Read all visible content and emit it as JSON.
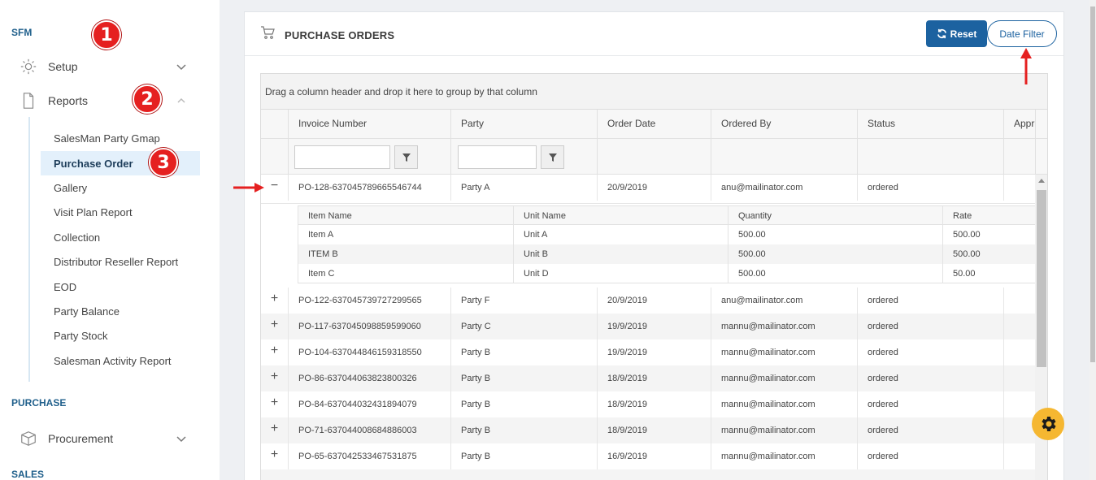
{
  "sidebar": {
    "section_sfm": "SFM",
    "setup_label": "Setup",
    "reports_label": "Reports",
    "sub_items": [
      "SalesMan Party Gmap",
      "Purchase Order",
      "Gallery",
      "Visit Plan Report",
      "Collection",
      "Distributor Reseller Report",
      "EOD",
      "Party Balance",
      "Party Stock",
      "Salesman Activity Report"
    ],
    "active_item": "Purchase Order",
    "section_purchase": "PURCHASE",
    "procurement_label": "Procurement",
    "section_sales": "SALES"
  },
  "badges": [
    "1",
    "2",
    "3"
  ],
  "header": {
    "title": "PURCHASE ORDERS",
    "reset_label": "Reset",
    "date_filter_label": "Date Filter"
  },
  "grid": {
    "group_hint": "Drag a column header and drop it here to group by that column",
    "columns": [
      "Invoice Number",
      "Party",
      "Order Date",
      "Ordered By",
      "Status",
      "Appr"
    ],
    "rows": [
      {
        "expander": "−",
        "invoice": "PO-128-637045789665546744",
        "party": "Party A",
        "date": "20/9/2019",
        "by": "anu@mailinator.com",
        "status": "ordered"
      },
      {
        "expander": "+",
        "invoice": "PO-122-637045739727299565",
        "party": "Party F",
        "date": "20/9/2019",
        "by": "anu@mailinator.com",
        "status": "ordered"
      },
      {
        "expander": "+",
        "invoice": "PO-117-637045098859599060",
        "party": "Party C",
        "date": "19/9/2019",
        "by": "mannu@mailinator.com",
        "status": "ordered"
      },
      {
        "expander": "+",
        "invoice": "PO-104-637044846159318550",
        "party": "Party B",
        "date": "19/9/2019",
        "by": "mannu@mailinator.com",
        "status": "ordered"
      },
      {
        "expander": "+",
        "invoice": "PO-86-637044063823800326",
        "party": "Party B",
        "date": "18/9/2019",
        "by": "mannu@mailinator.com",
        "status": "ordered"
      },
      {
        "expander": "+",
        "invoice": "PO-84-637044032431894079",
        "party": "Party B",
        "date": "18/9/2019",
        "by": "mannu@mailinator.com",
        "status": "ordered"
      },
      {
        "expander": "+",
        "invoice": "PO-71-637044008684886003",
        "party": "Party B",
        "date": "18/9/2019",
        "by": "mannu@mailinator.com",
        "status": "ordered"
      },
      {
        "expander": "+",
        "invoice": "PO-65-637042533467531875",
        "party": "Party B",
        "date": "16/9/2019",
        "by": "mannu@mailinator.com",
        "status": "ordered"
      }
    ],
    "detail": {
      "columns": [
        "Item Name",
        "Unit Name",
        "Quantity",
        "Rate"
      ],
      "rows": [
        {
          "item": "Item A",
          "unit": "Unit A",
          "qty": "500.00",
          "rate": "500.00"
        },
        {
          "item": "ITEM B",
          "unit": "Unit B",
          "qty": "500.00",
          "rate": "500.00"
        },
        {
          "item": "Item C",
          "unit": "Unit D",
          "qty": "500.00",
          "rate": "50.00"
        }
      ]
    }
  },
  "colors": {
    "accent": "#1c62a0",
    "badge": "#e52020",
    "fab": "#f5b731",
    "annotation_arrow": "#e52020"
  }
}
